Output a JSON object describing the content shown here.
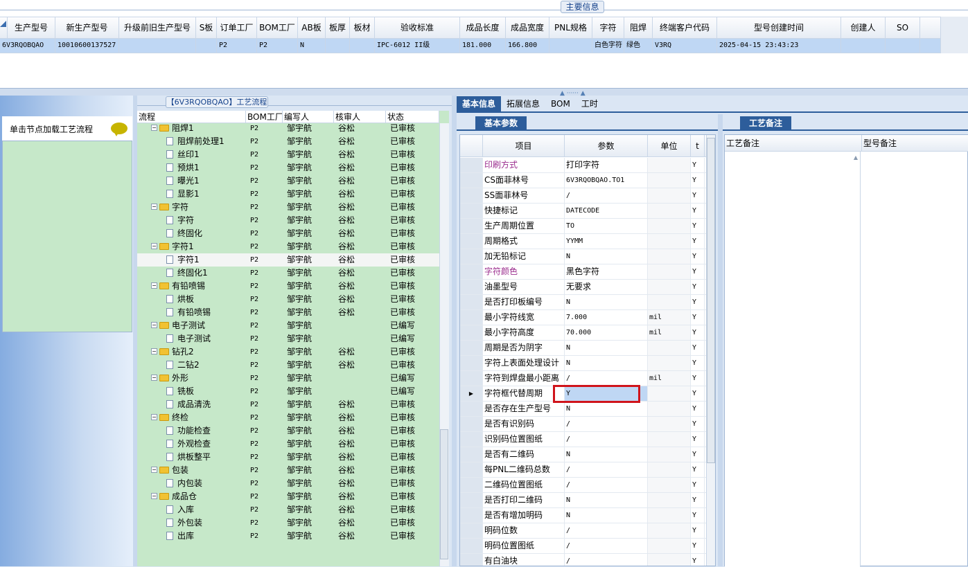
{
  "main_info": {
    "title": "主要信息",
    "columns": [
      "生产型号",
      "新生产型号",
      "升级前旧生产型号",
      "S板",
      "订单工厂",
      "BOM工厂",
      "AB板",
      "板厚",
      "板材",
      "验收标准",
      "成品长度",
      "成品宽度",
      "PNL规格",
      "字符",
      "阻焊",
      "终端客户代码",
      "型号创建时间",
      "创建人",
      "SO"
    ],
    "row": [
      "6V3RQOBQAO",
      "10010600137527",
      "",
      "",
      "P2",
      "P2",
      "N",
      "",
      "",
      "IPC-6012 II级",
      "181.000",
      "166.800",
      "",
      "白色字符",
      "绿色",
      "V3RQ",
      "2025-04-15 23:43:23",
      "",
      ""
    ]
  },
  "left_panel": {
    "hint": "单击节点加载工艺流程"
  },
  "process": {
    "title": "【6V3RQOBQAO】工艺流程",
    "columns": [
      "流程",
      "BOM工厂",
      "编写人",
      "核审人",
      "状态"
    ],
    "rows": [
      {
        "name": "阻焊1",
        "level": 0,
        "factory": "P2",
        "writer": "邹宇航",
        "reviewer": "谷松",
        "status": "已审核"
      },
      {
        "name": "阻焊前处理1",
        "level": 1,
        "factory": "P2",
        "writer": "邹宇航",
        "reviewer": "谷松",
        "status": "已审核"
      },
      {
        "name": "丝印1",
        "level": 1,
        "factory": "P2",
        "writer": "邹宇航",
        "reviewer": "谷松",
        "status": "已审核"
      },
      {
        "name": "预烘1",
        "level": 1,
        "factory": "P2",
        "writer": "邹宇航",
        "reviewer": "谷松",
        "status": "已审核"
      },
      {
        "name": "曝光1",
        "level": 1,
        "factory": "P2",
        "writer": "邹宇航",
        "reviewer": "谷松",
        "status": "已审核"
      },
      {
        "name": "显影1",
        "level": 1,
        "factory": "P2",
        "writer": "邹宇航",
        "reviewer": "谷松",
        "status": "已审核"
      },
      {
        "name": "字符",
        "level": 0,
        "factory": "P2",
        "writer": "邹宇航",
        "reviewer": "谷松",
        "status": "已审核"
      },
      {
        "name": "字符",
        "level": 1,
        "factory": "P2",
        "writer": "邹宇航",
        "reviewer": "谷松",
        "status": "已审核"
      },
      {
        "name": "终固化",
        "level": 1,
        "factory": "P2",
        "writer": "邹宇航",
        "reviewer": "谷松",
        "status": "已审核"
      },
      {
        "name": "字符1",
        "level": 0,
        "factory": "P2",
        "writer": "邹宇航",
        "reviewer": "谷松",
        "status": "已审核"
      },
      {
        "name": "字符1",
        "level": 1,
        "factory": "P2",
        "writer": "邹宇航",
        "reviewer": "谷松",
        "status": "已审核",
        "selected": true
      },
      {
        "name": "终固化1",
        "level": 1,
        "factory": "P2",
        "writer": "邹宇航",
        "reviewer": "谷松",
        "status": "已审核"
      },
      {
        "name": "有铅喷锡",
        "level": 0,
        "factory": "P2",
        "writer": "邹宇航",
        "reviewer": "谷松",
        "status": "已审核"
      },
      {
        "name": "烘板",
        "level": 1,
        "factory": "P2",
        "writer": "邹宇航",
        "reviewer": "谷松",
        "status": "已审核"
      },
      {
        "name": "有铅喷锡",
        "level": 1,
        "factory": "P2",
        "writer": "邹宇航",
        "reviewer": "谷松",
        "status": "已审核"
      },
      {
        "name": "电子测试",
        "level": 0,
        "factory": "P2",
        "writer": "邹宇航",
        "reviewer": "",
        "status": "已编写"
      },
      {
        "name": "电子测试",
        "level": 1,
        "factory": "P2",
        "writer": "邹宇航",
        "reviewer": "",
        "status": "已编写"
      },
      {
        "name": "钻孔2",
        "level": 0,
        "factory": "P2",
        "writer": "邹宇航",
        "reviewer": "谷松",
        "status": "已审核"
      },
      {
        "name": "二钻2",
        "level": 1,
        "factory": "P2",
        "writer": "邹宇航",
        "reviewer": "谷松",
        "status": "已审核"
      },
      {
        "name": "外形",
        "level": 0,
        "factory": "P2",
        "writer": "邹宇航",
        "reviewer": "",
        "status": "已编写"
      },
      {
        "name": "铣板",
        "level": 1,
        "factory": "P2",
        "writer": "邹宇航",
        "reviewer": "",
        "status": "已编写"
      },
      {
        "name": "成品清洗",
        "level": 1,
        "factory": "P2",
        "writer": "邹宇航",
        "reviewer": "谷松",
        "status": "已审核"
      },
      {
        "name": "终检",
        "level": 0,
        "factory": "P2",
        "writer": "邹宇航",
        "reviewer": "谷松",
        "status": "已审核"
      },
      {
        "name": "功能检查",
        "level": 1,
        "factory": "P2",
        "writer": "邹宇航",
        "reviewer": "谷松",
        "status": "已审核"
      },
      {
        "name": "外观检查",
        "level": 1,
        "factory": "P2",
        "writer": "邹宇航",
        "reviewer": "谷松",
        "status": "已审核"
      },
      {
        "name": "烘板整平",
        "level": 1,
        "factory": "P2",
        "writer": "邹宇航",
        "reviewer": "谷松",
        "status": "已审核"
      },
      {
        "name": "包装",
        "level": 0,
        "factory": "P2",
        "writer": "邹宇航",
        "reviewer": "谷松",
        "status": "已审核"
      },
      {
        "name": "内包装",
        "level": 1,
        "factory": "P2",
        "writer": "邹宇航",
        "reviewer": "谷松",
        "status": "已审核"
      },
      {
        "name": "成品仓",
        "level": 0,
        "factory": "P2",
        "writer": "邹宇航",
        "reviewer": "谷松",
        "status": "已审核"
      },
      {
        "name": "入库",
        "level": 1,
        "factory": "P2",
        "writer": "邹宇航",
        "reviewer": "谷松",
        "status": "已审核"
      },
      {
        "name": "外包装",
        "level": 1,
        "factory": "P2",
        "writer": "邹宇航",
        "reviewer": "谷松",
        "status": "已审核"
      },
      {
        "name": "出库",
        "level": 1,
        "factory": "P2",
        "writer": "邹宇航",
        "reviewer": "谷松",
        "status": "已审核"
      }
    ]
  },
  "tabs": [
    "基本信息",
    "拓展信息",
    "BOM",
    "工时"
  ],
  "basic_params": {
    "tab": "基本参数",
    "columns": [
      "项目",
      "参数",
      "单位",
      "t"
    ],
    "rows": [
      {
        "item": "印刷方式",
        "value": "打印字符",
        "unit": "",
        "flag": "Y",
        "highlight": true
      },
      {
        "item": "CS面菲林号",
        "value": "6V3RQOBQAO.TO1",
        "unit": "",
        "flag": "Y"
      },
      {
        "item": "SS面菲林号",
        "value": "/",
        "unit": "",
        "flag": "Y"
      },
      {
        "item": "快捷标记",
        "value": "DATECODE",
        "unit": "",
        "flag": "Y"
      },
      {
        "item": "生产周期位置",
        "value": "TO",
        "unit": "",
        "flag": "Y"
      },
      {
        "item": "周期格式",
        "value": "YYMM",
        "unit": "",
        "flag": "Y"
      },
      {
        "item": "加无铅标记",
        "value": "N",
        "unit": "",
        "flag": "Y"
      },
      {
        "item": "字符颜色",
        "value": "黑色字符",
        "unit": "",
        "flag": "Y",
        "highlight": true
      },
      {
        "item": "油墨型号",
        "value": "无要求",
        "unit": "",
        "flag": "Y"
      },
      {
        "item": "是否打印板编号",
        "value": "N",
        "unit": "",
        "flag": "Y"
      },
      {
        "item": "最小字符线宽",
        "value": "7.000",
        "unit": "mil",
        "flag": "Y"
      },
      {
        "item": "最小字符高度",
        "value": "70.000",
        "unit": "mil",
        "flag": "Y"
      },
      {
        "item": "周期是否为阴字",
        "value": "N",
        "unit": "",
        "flag": "Y"
      },
      {
        "item": "字符上表面处理设计",
        "value": "N",
        "unit": "",
        "flag": "Y"
      },
      {
        "item": "字符到焊盘最小距离",
        "value": "/",
        "unit": "mil",
        "flag": "Y"
      },
      {
        "item": "字符框代替周期",
        "value": "Y",
        "unit": "",
        "flag": "Y",
        "current": true
      },
      {
        "item": "是否存在生产型号",
        "value": "N",
        "unit": "",
        "flag": "Y"
      },
      {
        "item": "是否有识别码",
        "value": "/",
        "unit": "",
        "flag": "Y"
      },
      {
        "item": "识别码位置图纸",
        "value": "/",
        "unit": "",
        "flag": "Y"
      },
      {
        "item": "是否有二维码",
        "value": "N",
        "unit": "",
        "flag": "Y"
      },
      {
        "item": "每PNL二维码总数",
        "value": "/",
        "unit": "",
        "flag": "Y"
      },
      {
        "item": "二维码位置图纸",
        "value": "/",
        "unit": "",
        "flag": "Y"
      },
      {
        "item": "是否打印二维码",
        "value": "N",
        "unit": "",
        "flag": "Y"
      },
      {
        "item": "是否有增加明码",
        "value": "N",
        "unit": "",
        "flag": "Y"
      },
      {
        "item": "明码位数",
        "value": "/",
        "unit": "",
        "flag": "Y"
      },
      {
        "item": "明码位置图纸",
        "value": "/",
        "unit": "",
        "flag": "Y"
      },
      {
        "item": "有白油块",
        "value": "/",
        "unit": "",
        "flag": "Y"
      }
    ]
  },
  "notes": {
    "tab": "工艺备注",
    "columns": [
      "工艺备注",
      "型号备注"
    ]
  },
  "colors": {
    "accent": "#2d5d9b",
    "highlight_text": "#9b2d8e",
    "tree_bg": "#c6e8c9",
    "selected_row": "#bfd7f4",
    "red_box": "#d0141b"
  }
}
